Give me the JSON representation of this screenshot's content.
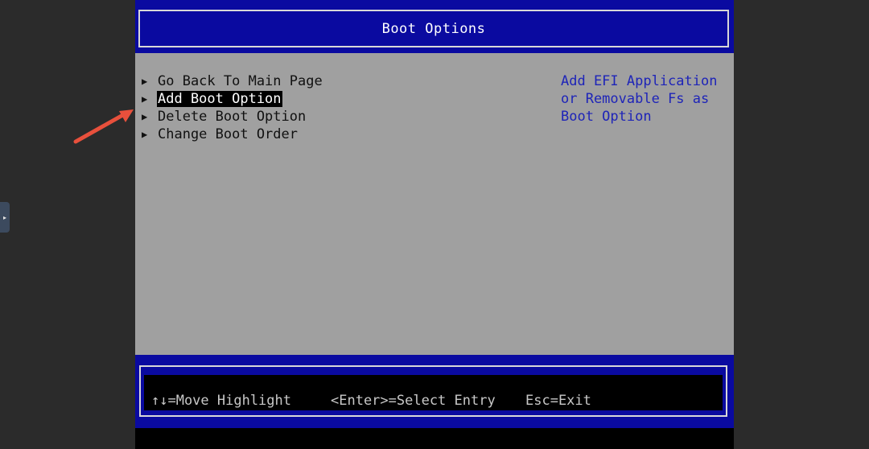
{
  "header": {
    "title": "Boot Options"
  },
  "menu": {
    "items": [
      {
        "label": "Go Back To Main Page",
        "selected": false
      },
      {
        "label": "Add Boot Option",
        "selected": true
      },
      {
        "label": "Delete Boot Option",
        "selected": false
      },
      {
        "label": "Change Boot Order",
        "selected": false
      }
    ],
    "arrow_glyph": "▶"
  },
  "help": {
    "lines": [
      "Add EFI Application",
      "or Removable Fs as",
      "Boot Option"
    ]
  },
  "footer": {
    "move_hint": "↑↓=Move Highlight",
    "select_hint": "<Enter>=Select Entry",
    "exit_hint": "Esc=Exit"
  },
  "side_handle": {
    "glyph": "▸"
  },
  "colors": {
    "bios_blue": "#0a0aa0",
    "body_gray": "#a0a0a0",
    "help_text": "#1e24b8",
    "annotation_arrow": "#e8503c"
  }
}
